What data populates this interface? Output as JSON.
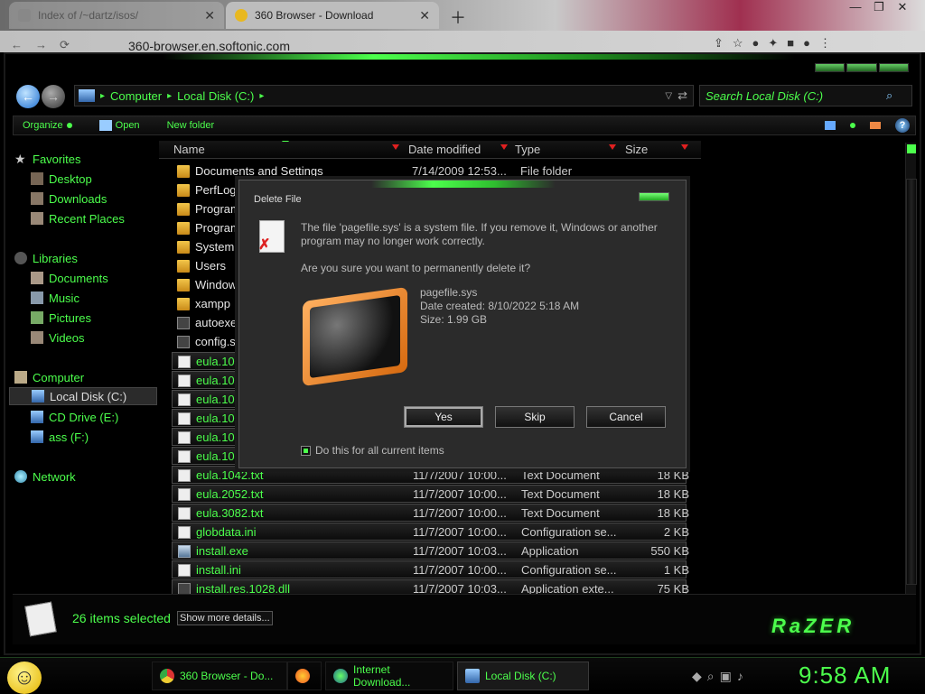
{
  "browser": {
    "tabs": [
      {
        "label": "Index of /~dartz/isos/"
      },
      {
        "label": "360 Browser - Download"
      }
    ],
    "url": "360-browser.en.softonic.com"
  },
  "explorer": {
    "breadcrumb": [
      "Computer",
      "Local Disk (C:)"
    ],
    "search_placeholder": "Search Local Disk (C:)",
    "toolbar": {
      "organize": "Organize",
      "open": "Open",
      "new_folder": "New folder"
    },
    "nav": {
      "favorites": "Favorites",
      "desktop": "Desktop",
      "downloads": "Downloads",
      "recent": "Recent Places",
      "libraries": "Libraries",
      "documents": "Documents",
      "music": "Music",
      "pictures": "Pictures",
      "videos": "Videos",
      "computer": "Computer",
      "local_disk": "Local Disk (C:)",
      "cd_drive": "CD Drive (E:)",
      "ass": "ass (F:)",
      "network": "Network"
    },
    "columns": {
      "name": "Name",
      "date": "Date modified",
      "type": "Type",
      "size": "Size"
    },
    "files": [
      {
        "name": "Documents and Settings",
        "date": "7/14/2009 12:53...",
        "type": "File folder",
        "size": ""
      },
      {
        "name": "PerfLogs",
        "date": "",
        "type": "",
        "size": ""
      },
      {
        "name": "Program",
        "date": "",
        "type": "",
        "size": ""
      },
      {
        "name": "ProgramD",
        "date": "",
        "type": "",
        "size": ""
      },
      {
        "name": "System V",
        "date": "",
        "type": "",
        "size": ""
      },
      {
        "name": "Users",
        "date": "",
        "type": "",
        "size": ""
      },
      {
        "name": "Windows",
        "date": "",
        "type": "",
        "size": ""
      },
      {
        "name": "xampp",
        "date": "",
        "type": "",
        "size": ""
      },
      {
        "name": "autoexec",
        "date": "",
        "type": "",
        "size": ""
      },
      {
        "name": "config.sy",
        "date": "",
        "type": "",
        "size": ""
      },
      {
        "name": "eula.1028",
        "date": "",
        "type": "",
        "size": ""
      },
      {
        "name": "eula.1031",
        "date": "",
        "type": "",
        "size": ""
      },
      {
        "name": "eula.1033",
        "date": "",
        "type": "",
        "size": ""
      },
      {
        "name": "eula.1036",
        "date": "",
        "type": "",
        "size": ""
      },
      {
        "name": "eula.1040",
        "date": "",
        "type": "",
        "size": ""
      },
      {
        "name": "eula.1041",
        "date": "",
        "type": "",
        "size": ""
      },
      {
        "name": "eula.1042.txt",
        "date": "11/7/2007 10:00...",
        "type": "Text Document",
        "size": "18 KB"
      },
      {
        "name": "eula.2052.txt",
        "date": "11/7/2007 10:00...",
        "type": "Text Document",
        "size": "18 KB"
      },
      {
        "name": "eula.3082.txt",
        "date": "11/7/2007 10:00...",
        "type": "Text Document",
        "size": "18 KB"
      },
      {
        "name": "globdata.ini",
        "date": "11/7/2007 10:00...",
        "type": "Configuration se...",
        "size": "2 KB"
      },
      {
        "name": "install.exe",
        "date": "11/7/2007 10:03...",
        "type": "Application",
        "size": "550 KB"
      },
      {
        "name": "install.ini",
        "date": "11/7/2007 10:00...",
        "type": "Configuration se...",
        "size": "1 KB"
      },
      {
        "name": "install.res.1028.dll",
        "date": "11/7/2007 10:03...",
        "type": "Application exte...",
        "size": "75 KB"
      }
    ],
    "status": {
      "count": "26 items selected",
      "more": "Show more details..."
    },
    "logo": "RaZER"
  },
  "dialog": {
    "title": "Delete File",
    "message": "The file 'pagefile.sys' is a system file. If you remove it, Windows or another program may no longer work correctly.",
    "question": "Are you sure you want to permanently delete it?",
    "file_name": "pagefile.sys",
    "file_date": "Date created: 8/10/2022 5:18 AM",
    "file_size": "Size: 1.99 GB",
    "yes": "Yes",
    "skip": "Skip",
    "cancel": "Cancel",
    "checkbox": "Do this for all current items"
  },
  "taskbar": {
    "items": [
      "360 Browser - Do...",
      "Internet Download...",
      "Local Disk (C:)"
    ],
    "clock": "9:58 AM"
  }
}
